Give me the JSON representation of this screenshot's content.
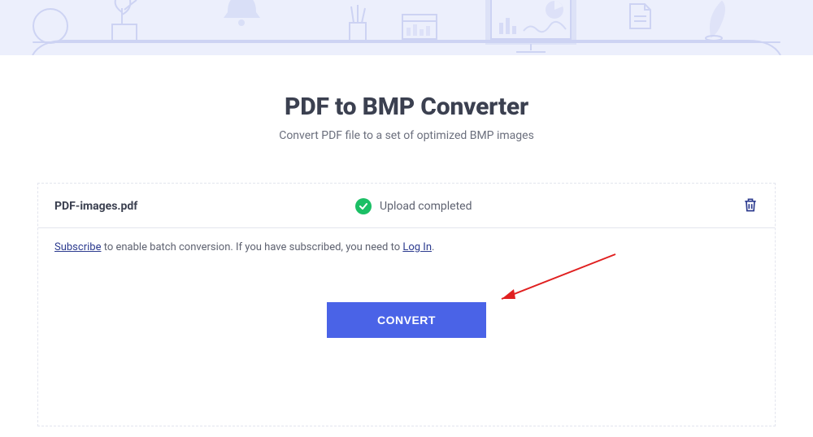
{
  "header": {
    "title": "PDF to BMP Converter",
    "subtitle": "Convert PDF file to a set of optimized BMP images"
  },
  "file": {
    "name": "PDF-images.pdf",
    "status": "Upload completed"
  },
  "note": {
    "subscribe_link": "Subscribe",
    "mid_text_1": " to enable batch conversion. If you have subscribed, you need to ",
    "login_link": "Log In",
    "end": "."
  },
  "convert": {
    "label": "CONVERT"
  },
  "colors": {
    "primary": "#4a63e7",
    "success": "#1bbf65",
    "text_dark": "#3b4050",
    "text_mid": "#5e6270",
    "link": "#2c3b8f"
  }
}
